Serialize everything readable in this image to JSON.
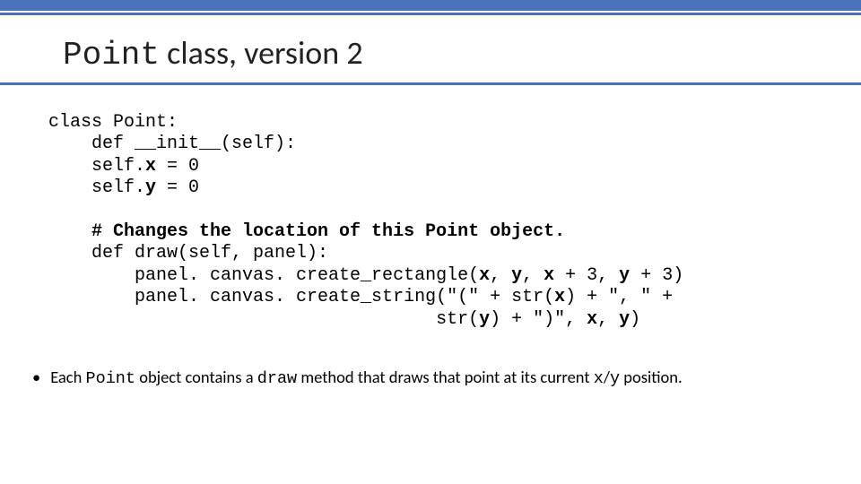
{
  "title": {
    "mono": "Point",
    "rest": " class, version 2"
  },
  "code": {
    "l1": "class Point:",
    "l2": "    def __init__(self):",
    "l3_pre": "    self.",
    "l3_var": "x",
    "l3_post": " = 0",
    "l4_pre": "    self.",
    "l4_var": "y",
    "l4_post": " = 0",
    "blank": "",
    "l6_comment": "    # Changes the location of this Point object.",
    "l7": "    def draw(self, panel):",
    "l8_pre": "        panel. canvas. create_rectangle(",
    "l8_b1": "x",
    "l8_s1": ", ",
    "l8_b2": "y",
    "l8_s2": ", ",
    "l8_b3": "x",
    "l8_s3": " + 3, ",
    "l8_b4": "y",
    "l8_s4": " + 3)",
    "l9_pre": "        panel. canvas. create_string(\"(\" + str(",
    "l9_b1": "x",
    "l9_s1": ") + \", \" + ",
    "l10_pre": "                                    str(",
    "l10_b1": "y",
    "l10_s1": ") + \")\", ",
    "l10_b2": "x",
    "l10_s2": ", ",
    "l10_b3": "y",
    "l10_s3": ")"
  },
  "bullet": {
    "p1": "Each ",
    "m1": "Point",
    "p2": " object contains a ",
    "m2": "draw",
    "p3": " method that draws that point at its current ",
    "m3": "x",
    "p4": "/",
    "m4": "y",
    "p5": " position."
  }
}
